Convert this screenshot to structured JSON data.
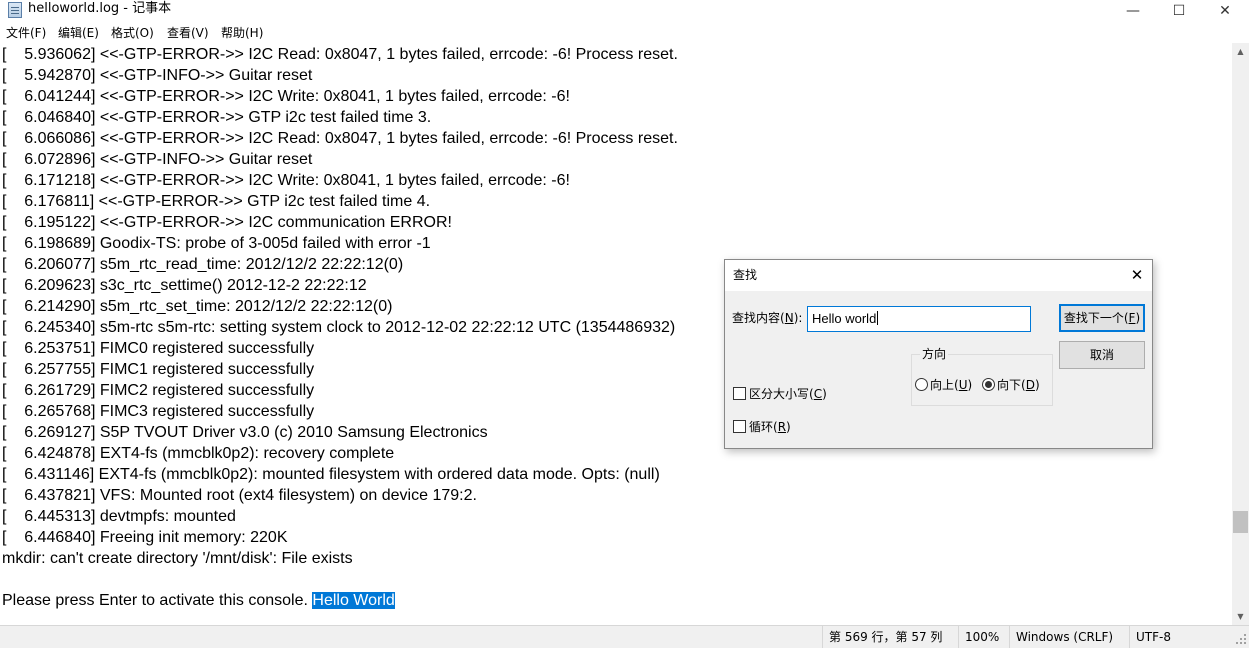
{
  "window": {
    "title": "helloworld.log - 记事本",
    "controls": {
      "minimize": "—",
      "maximize": "☐",
      "close": "✕"
    }
  },
  "menu": [
    {
      "label": "文件(F)"
    },
    {
      "label": "编辑(E)"
    },
    {
      "label": "格式(O)"
    },
    {
      "label": "查看(V)"
    },
    {
      "label": "帮助(H)"
    }
  ],
  "editor": {
    "lines": [
      "[    5.936062] <<-GTP-ERROR->> I2C Read: 0x8047, 1 bytes failed, errcode: -6! Process reset.",
      "[    5.942870] <<-GTP-INFO->> Guitar reset",
      "[    6.041244] <<-GTP-ERROR->> I2C Write: 0x8041, 1 bytes failed, errcode: -6!",
      "[    6.046840] <<-GTP-ERROR->> GTP i2c test failed time 3.",
      "[    6.066086] <<-GTP-ERROR->> I2C Read: 0x8047, 1 bytes failed, errcode: -6! Process reset.",
      "[    6.072896] <<-GTP-INFO->> Guitar reset",
      "[    6.171218] <<-GTP-ERROR->> I2C Write: 0x8041, 1 bytes failed, errcode: -6!",
      "[    6.176811] <<-GTP-ERROR->> GTP i2c test failed time 4.",
      "[    6.195122] <<-GTP-ERROR->> I2C communication ERROR!",
      "[    6.198689] Goodix-TS: probe of 3-005d failed with error -1",
      "[    6.206077] s5m_rtc_read_time: 2012/12/2 22:22:12(0)",
      "[    6.209623] s3c_rtc_settime() 2012-12-2 22:22:12",
      "[    6.214290] s5m_rtc_set_time: 2012/12/2 22:22:12(0)",
      "[    6.245340] s5m-rtc s5m-rtc: setting system clock to 2012-12-02 22:22:12 UTC (1354486932)",
      "[    6.253751] FIMC0 registered successfully",
      "[    6.257755] FIMC1 registered successfully",
      "[    6.261729] FIMC2 registered successfully",
      "[    6.265768] FIMC3 registered successfully",
      "[    6.269127] S5P TVOUT Driver v3.0 (c) 2010 Samsung Electronics",
      "[    6.424878] EXT4-fs (mmcblk0p2): recovery complete",
      "[    6.431146] EXT4-fs (mmcblk0p2): mounted filesystem with ordered data mode. Opts: (null)",
      "[    6.437821] VFS: Mounted root (ext4 filesystem) on device 179:2.",
      "[    6.445313] devtmpfs: mounted",
      "[    6.446840] Freeing init memory: 220K",
      "mkdir: can't create directory '/mnt/disk': File exists",
      ""
    ],
    "last_line_prefix": "Please press Enter to activate this console. ",
    "selected_text": "Hello World"
  },
  "scrollbar": {
    "up_arrow": "▲",
    "down_arrow": "▼"
  },
  "find_dialog": {
    "title": "查找",
    "close": "✕",
    "find_label": "查找内容",
    "find_label_key": "(N):",
    "find_label_hotkey": "N",
    "find_value": "Hello world",
    "find_next_label": "查找下一个",
    "find_next_hotkey": "F",
    "cancel_label": "取消",
    "direction_label": "方向",
    "up_label": "向上",
    "up_hotkey": "U",
    "down_label": "向下",
    "down_hotkey": "D",
    "direction_selected": "down",
    "match_case_label": "区分大小写",
    "match_case_hotkey": "C",
    "match_case_checked": false,
    "wrap_label": "循环",
    "wrap_hotkey": "R",
    "wrap_checked": false
  },
  "status": {
    "position": "第 569 行，第 57 列",
    "zoom": "100%",
    "line_ending": "Windows (CRLF)",
    "encoding": "UTF-8"
  }
}
